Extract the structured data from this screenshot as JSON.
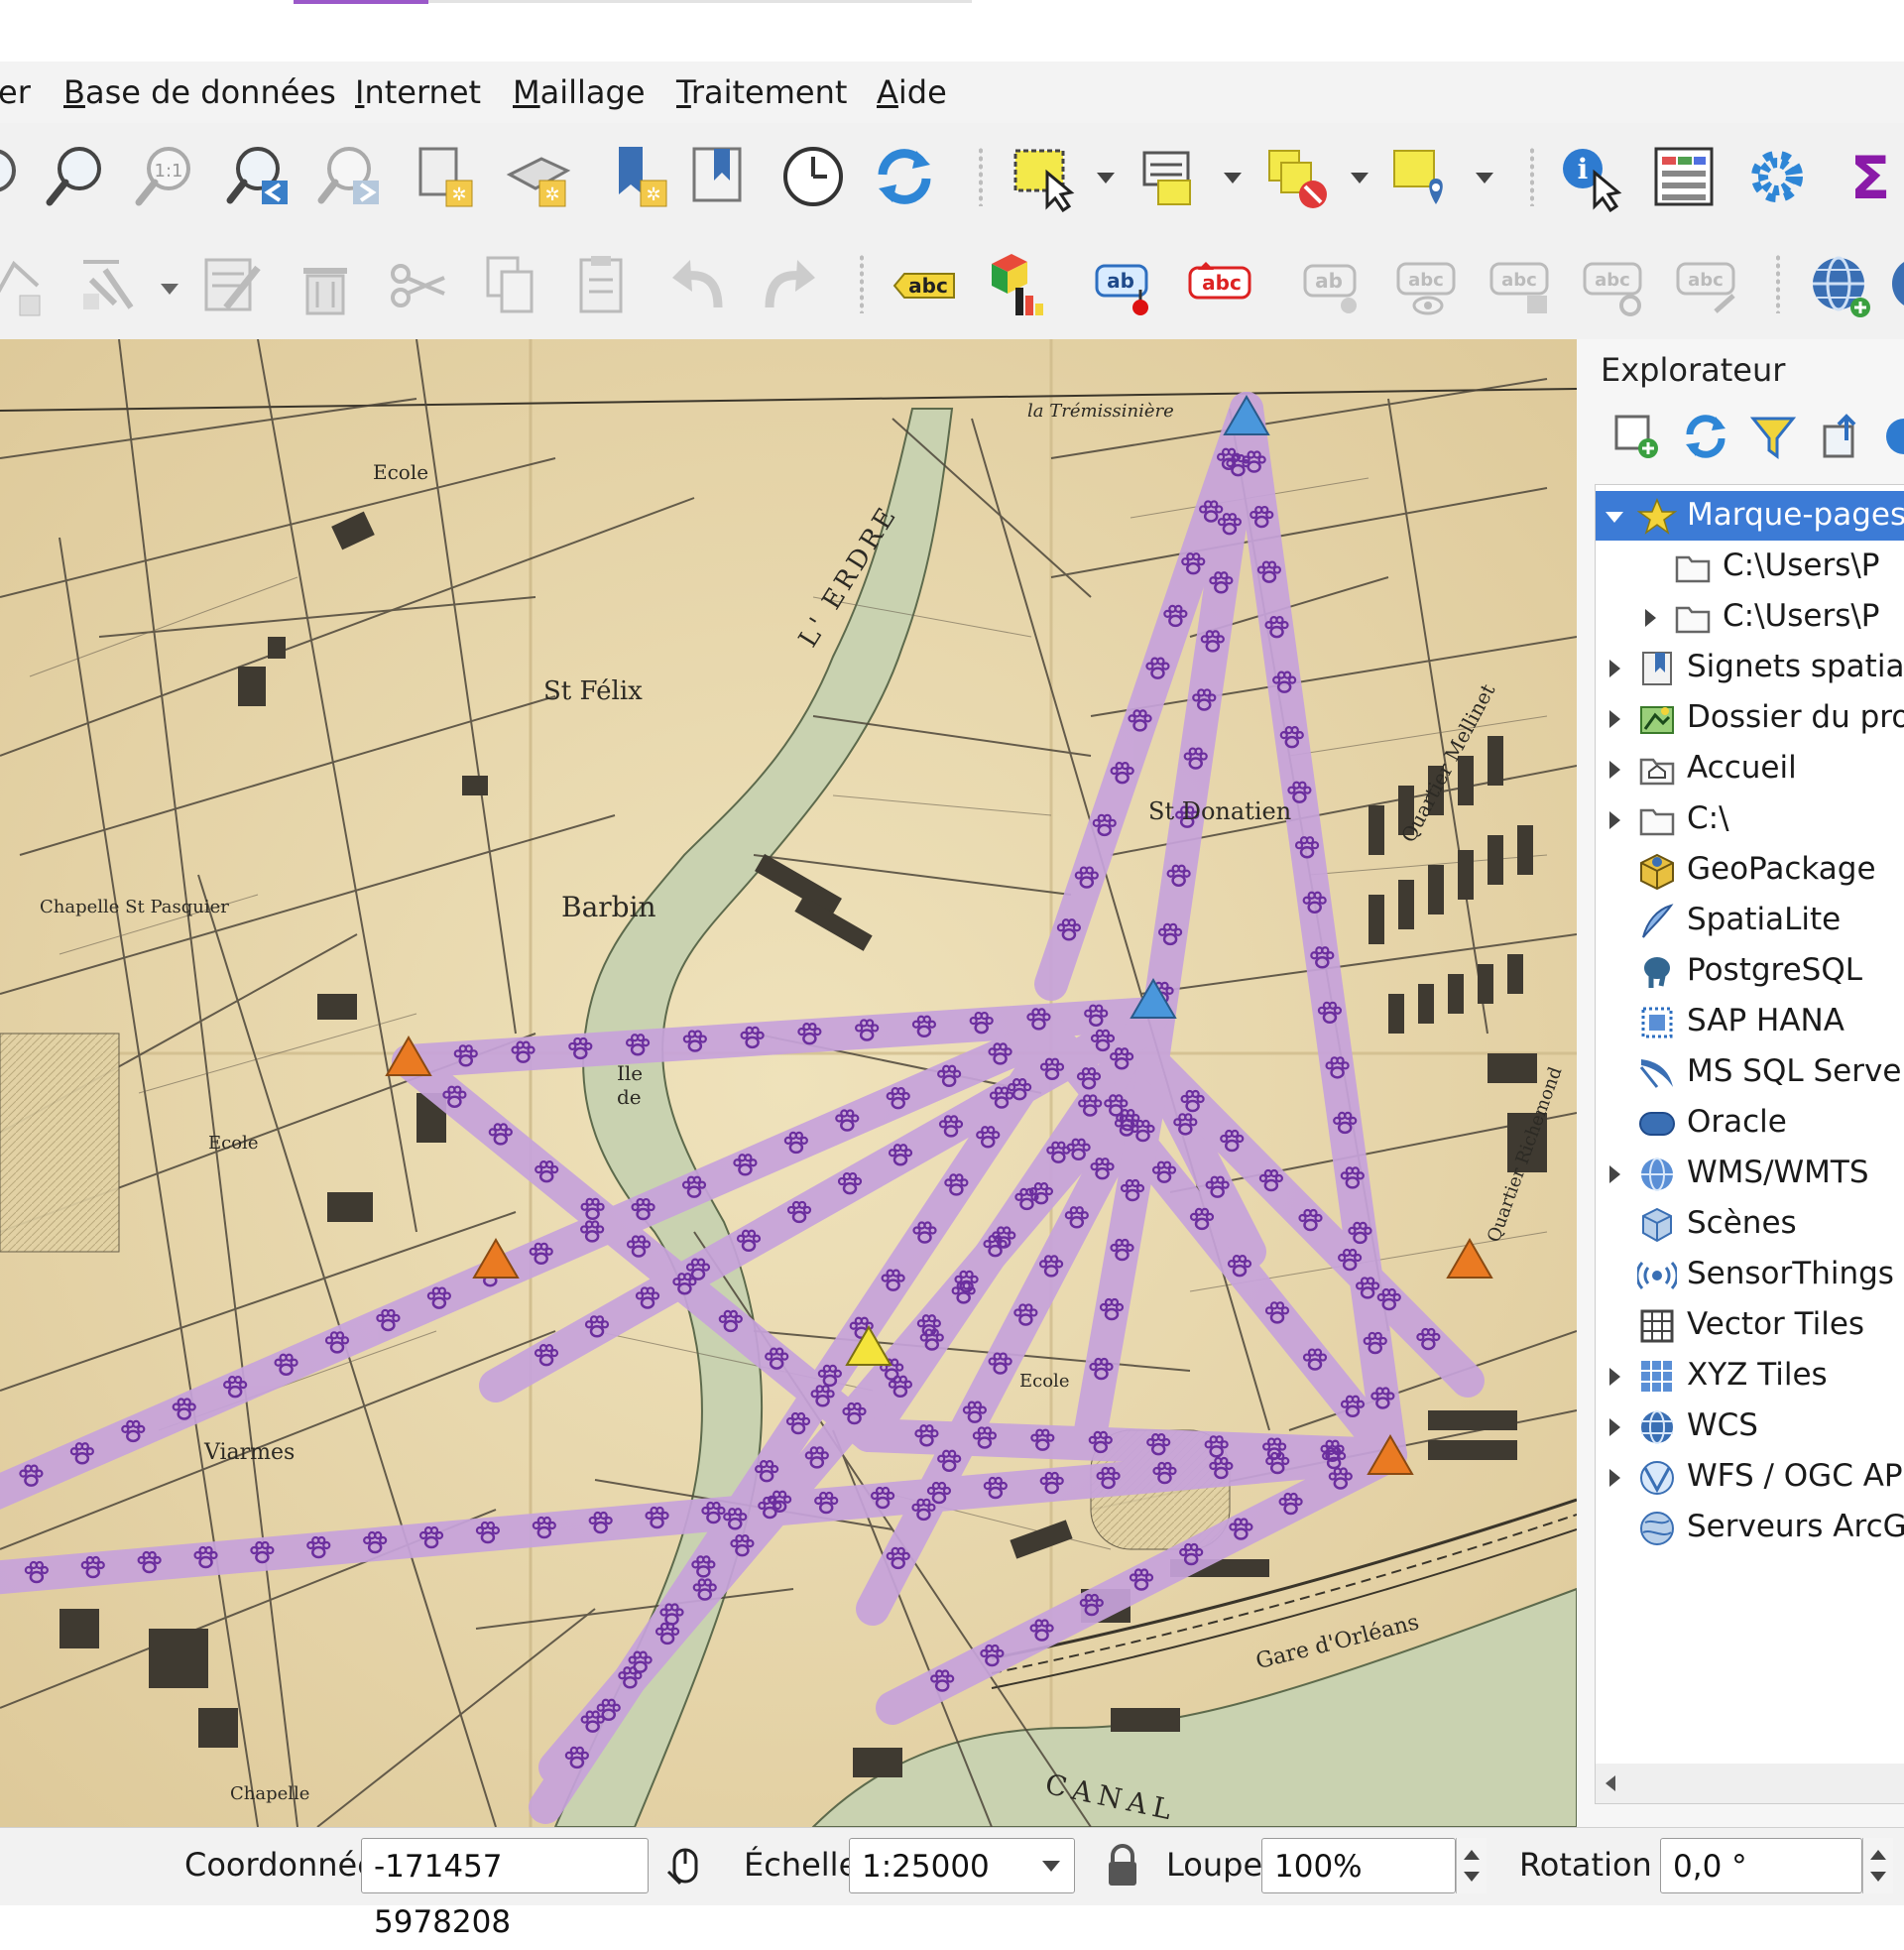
{
  "menu": {
    "items": [
      {
        "underline": "",
        "rest": "er"
      },
      {
        "underline": "B",
        "rest": "ase de données"
      },
      {
        "underline": "I",
        "rest": "nternet"
      },
      {
        "underline": "M",
        "rest": "aillage"
      },
      {
        "underline": "T",
        "rest": "raitement"
      },
      {
        "underline": "A",
        "rest": "ide"
      }
    ]
  },
  "toolbar2": {
    "label_tool_1": "abc",
    "label_tool_2": "ab",
    "label_tool_3": "abc",
    "label_tool_4": "ab",
    "label_tool_5": "abc",
    "label_tool_6": "abc",
    "label_tool_7": "abc",
    "label_tool_8": "abc"
  },
  "map_labels": {
    "l1": "la Trémissinière",
    "l2": "Ecole",
    "l3": "St Félix",
    "l4": "L' ERDRE",
    "l5": "Barbin",
    "l6": "Chapelle  St Pasquier",
    "l7": "Ile de",
    "l8": "St Donatien",
    "l9": "Quartier Mellinet",
    "l10": "Quartier Richemond",
    "l11": "Ecole",
    "l12": "Viarmes",
    "l13": "CANAL",
    "l14": "Gare d'Orléans",
    "l15": "Ecole",
    "l16": "Chapelle"
  },
  "explorer": {
    "title": "Explorateur",
    "items": [
      {
        "label": "Marque-pages",
        "icon": "star-icon",
        "expanded": true,
        "selected": true
      },
      {
        "label": "C:\\Users\\P",
        "icon": "folder-icon",
        "child": true
      },
      {
        "label": "C:\\Users\\P",
        "icon": "folder-icon",
        "child": true,
        "expandable": true
      },
      {
        "label": "Signets spatiaux",
        "icon": "spatial-bookmarks-icon",
        "expandable": true
      },
      {
        "label": "Dossier du projet",
        "icon": "project-folder-icon",
        "expandable": true
      },
      {
        "label": "Accueil",
        "icon": "home-folder-icon",
        "expandable": true
      },
      {
        "label": "C:\\",
        "icon": "drive-folder-icon",
        "expandable": true
      },
      {
        "label": "GeoPackage",
        "icon": "geopackage-icon"
      },
      {
        "label": "SpatiaLite",
        "icon": "spatialite-feather-icon"
      },
      {
        "label": "PostgreSQL",
        "icon": "postgresql-elephant-icon"
      },
      {
        "label": "SAP HANA",
        "icon": "sap-hana-icon"
      },
      {
        "label": "MS SQL Server",
        "icon": "mssql-icon"
      },
      {
        "label": "Oracle",
        "icon": "oracle-icon"
      },
      {
        "label": "WMS/WMTS",
        "icon": "wms-globe-icon",
        "expandable": true
      },
      {
        "label": "Scènes",
        "icon": "scenes-cube-icon"
      },
      {
        "label": "SensorThings",
        "icon": "sensorthings-icon"
      },
      {
        "label": "Vector Tiles",
        "icon": "vector-tiles-icon"
      },
      {
        "label": "XYZ Tiles",
        "icon": "xyz-tiles-icon",
        "expandable": true
      },
      {
        "label": "WCS",
        "icon": "wcs-globe-icon",
        "expandable": true
      },
      {
        "label": "WFS / OGC API",
        "icon": "wfs-icon",
        "expandable": true
      },
      {
        "label": "Serveurs ArcGIS",
        "icon": "arcgis-globe-icon"
      }
    ]
  },
  "status": {
    "coord_label": "Coordonnée",
    "coord_value": "-171457  5978208",
    "scale_label": "Échelle",
    "scale_value": "1:25000",
    "magnifier_label": "Loupe",
    "magnifier_value": "100%",
    "rotation_label": "Rotation",
    "rotation_value": "0,0 °"
  },
  "colors": {
    "route": "#c7a3db",
    "paw": "#6b2e9e",
    "triangle_blue": "#4a97dc",
    "triangle_orange": "#ea7a22",
    "triangle_yellow": "#f4e43b",
    "selection": "#3c7bd6"
  }
}
